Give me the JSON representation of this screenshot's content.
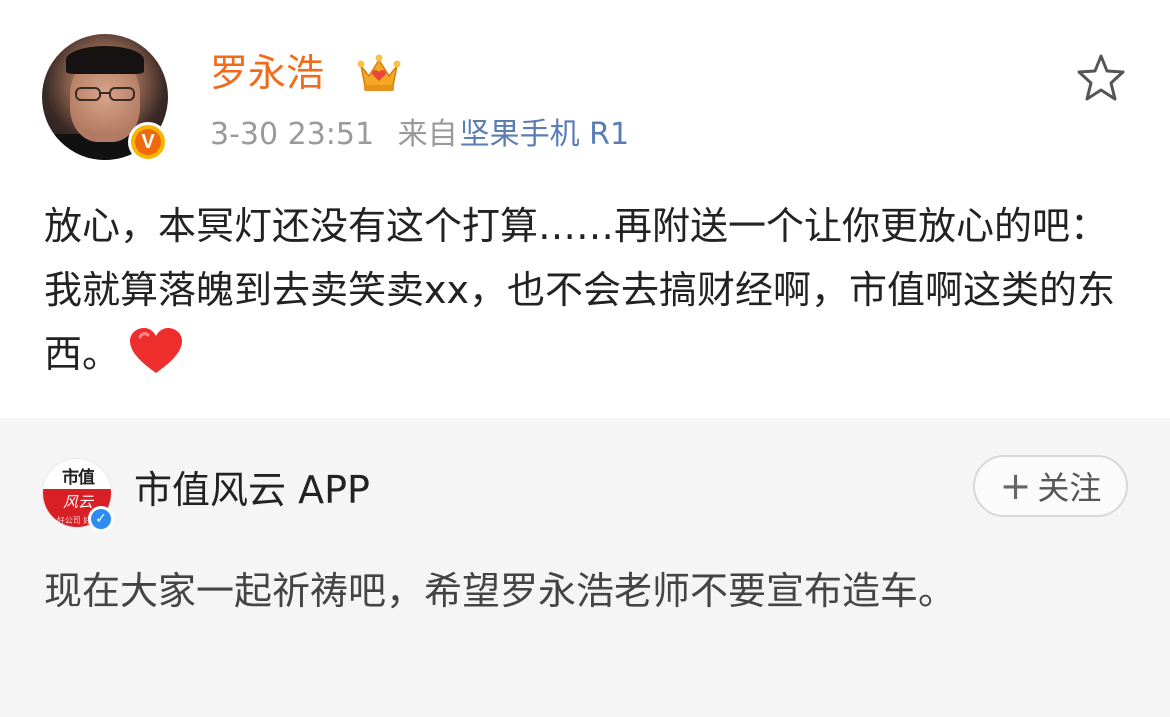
{
  "post": {
    "author": "罗永浩",
    "verified_badge": "V",
    "timestamp": "3-30 23:51",
    "source_prefix": "来自",
    "source_name": "坚果手机 R1",
    "content": "放心，本冥灯还没有这个打算……再附送一个让你更放心的吧：我就算落魄到去卖笑卖xx，也不会去搞财经啊，市值啊这类的东西。",
    "icons": [
      "crown-icon",
      "star-icon",
      "heart-icon"
    ],
    "colors": {
      "author_name": "#f26b1a",
      "source_link": "#5a7db5",
      "badge": "#f7b500"
    }
  },
  "repost": {
    "avatar_text_top": "市值",
    "avatar_text_mid": "风云",
    "avatar_text_bottom": "好公司 好股",
    "author": "市值风云 APP",
    "verified_badge": "✓",
    "follow_plus": "+",
    "follow_label": "关注",
    "content": "现在大家一起祈祷吧，希望罗永浩老师不要宣布造车。",
    "colors": {
      "background": "#f5f5f5",
      "verified": "#2d8cf0"
    }
  }
}
